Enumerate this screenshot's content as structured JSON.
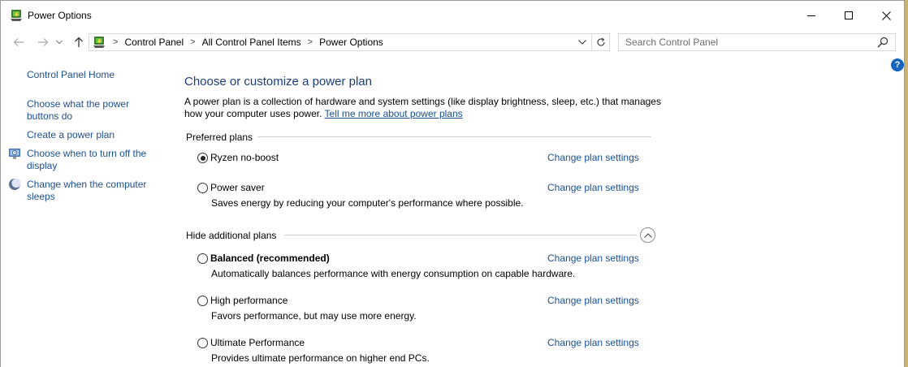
{
  "window": {
    "title": "Power Options"
  },
  "icons": {
    "app": "power-options-icon",
    "back": "back-arrow-icon",
    "forward": "forward-arrow-icon",
    "recent": "chevron-down-icon",
    "up": "up-arrow-icon",
    "address": "power-options-icon",
    "dropdown": "chevron-down-icon",
    "refresh": "refresh-icon",
    "search": "search-icon",
    "help": "help-icon",
    "display": "clock-monitor-icon",
    "sleep": "moon-icon",
    "collapse": "chevron-up-icon"
  },
  "address_bar": {
    "crumbs": [
      "Control Panel",
      "All Control Panel Items",
      "Power Options"
    ],
    "separator": ">"
  },
  "search": {
    "placeholder": "Search Control Panel"
  },
  "help": {
    "label": "?"
  },
  "sidebar": {
    "home": "Control Panel Home",
    "items": [
      "Choose what the power buttons do",
      "Create a power plan",
      "Choose when to turn off the display",
      "Change when the computer sleeps"
    ]
  },
  "main": {
    "title": "Choose or customize a power plan",
    "description": "A power plan is a collection of hardware and system settings (like display brightness, sleep, etc.) that manages how your computer uses power.",
    "learn_more": "Tell me more about power plans",
    "preferred_heading": "Preferred plans",
    "additional_heading": "Hide additional plans",
    "change_label": "Change plan settings",
    "plans": [
      {
        "name": "Ryzen no-boost",
        "description": "",
        "selected": true,
        "bold": false
      },
      {
        "name": "Power saver",
        "description": "Saves energy by reducing your computer's performance where possible.",
        "selected": false,
        "bold": false
      },
      {
        "name": "Balanced (recommended)",
        "description": "Automatically balances performance with energy consumption on capable hardware.",
        "selected": false,
        "bold": true
      },
      {
        "name": "High performance",
        "description": "Favors performance, but may use more energy.",
        "selected": false,
        "bold": false
      },
      {
        "name": "Ultimate Performance",
        "description": "Provides ultimate performance on higher end PCs.",
        "selected": false,
        "bold": false
      }
    ]
  },
  "colors": {
    "link": "#1a4f94",
    "title": "#1a3e7a",
    "help": "#1565c0"
  }
}
